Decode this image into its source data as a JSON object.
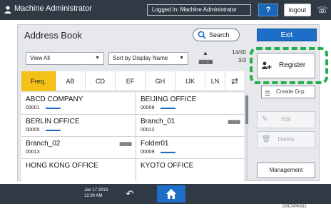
{
  "topbar": {
    "user_label": "Machine Administrator",
    "login_status": "Logged in: Machine Administrator",
    "help_label": "?",
    "logout_label": "logout"
  },
  "address_book": {
    "title": "Address Book",
    "search_label": "Search",
    "exit_label": "Exit",
    "view_select": "View All",
    "sort_select": "Sort by Display Name",
    "page_count": "14/40\n3/3",
    "tabs": [
      "Freq.",
      "AB",
      "CD",
      "EF",
      "GH",
      "IJK",
      "LN"
    ],
    "active_tab": "Freq.",
    "entries": [
      {
        "name": "ABCD COMPANY",
        "code": "00001",
        "icons": "▬ ▬ ▬"
      },
      {
        "name": "BEIJING OFFICE",
        "code": "00008",
        "icons": "▬ ▬ ▬"
      },
      {
        "name": "BERLIN OFFICE",
        "code": "00005",
        "icons": "▬ ▬ ▬"
      },
      {
        "name": "Branch_01",
        "code": "00012",
        "icons": ""
      },
      {
        "name": "Branch_02",
        "code": "00013",
        "icons": ""
      },
      {
        "name": "Folder01",
        "code": "00009",
        "icons": "▬ ▬ ▬"
      },
      {
        "name": "HONG KONG OFFICE",
        "code": "",
        "icons": ""
      },
      {
        "name": "KYOTO OFFICE",
        "code": "",
        "icons": ""
      }
    ],
    "register_label": "Register",
    "create_group_label": "Create Grp",
    "edit_label": "Edit",
    "delete_label": "Delete",
    "management_label": "Management"
  },
  "bottombar": {
    "datetime": "Jan 17 2019\n12:30 AM"
  },
  "figure_code": "D0CSPA531"
}
